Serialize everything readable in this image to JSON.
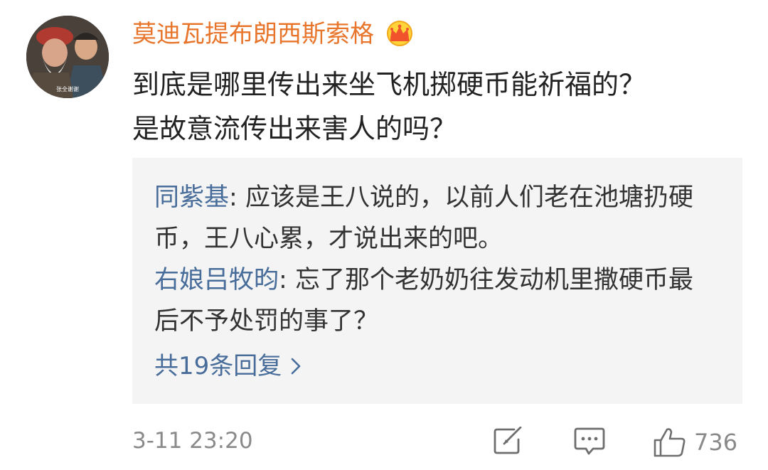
{
  "comment": {
    "username": "莫迪瓦提布朗西斯索格",
    "avatar_caption": "张全谢谢",
    "text": "到底是哪里传出来坐飞机掷硬币能祈福的？\n是故意流传出来害人的吗？",
    "timestamp": "3-11 23:20",
    "like_count": "736"
  },
  "replies": [
    {
      "author": "同紫基",
      "separator": ": ",
      "text": "应该是王八说的，以前人们老在池塘扔硬币，王八心累，才说出来的吧。"
    },
    {
      "author": "右娘吕牧昀",
      "separator": ": ",
      "text": "忘了那个老奶奶往发动机里撒硬币最后不予处罚的事了？"
    }
  ],
  "more_replies_label": "共19条回复",
  "icons": {
    "crown": "crown-badge-icon",
    "chevron": "chevron-right-icon",
    "share": "share-icon",
    "comment": "comment-icon",
    "like": "thumbs-up-icon"
  },
  "colors": {
    "username": "#e8752c",
    "reply_author": "#496d9a",
    "reply_background": "#f4f4f4",
    "meta_text": "#8a8a8a"
  }
}
